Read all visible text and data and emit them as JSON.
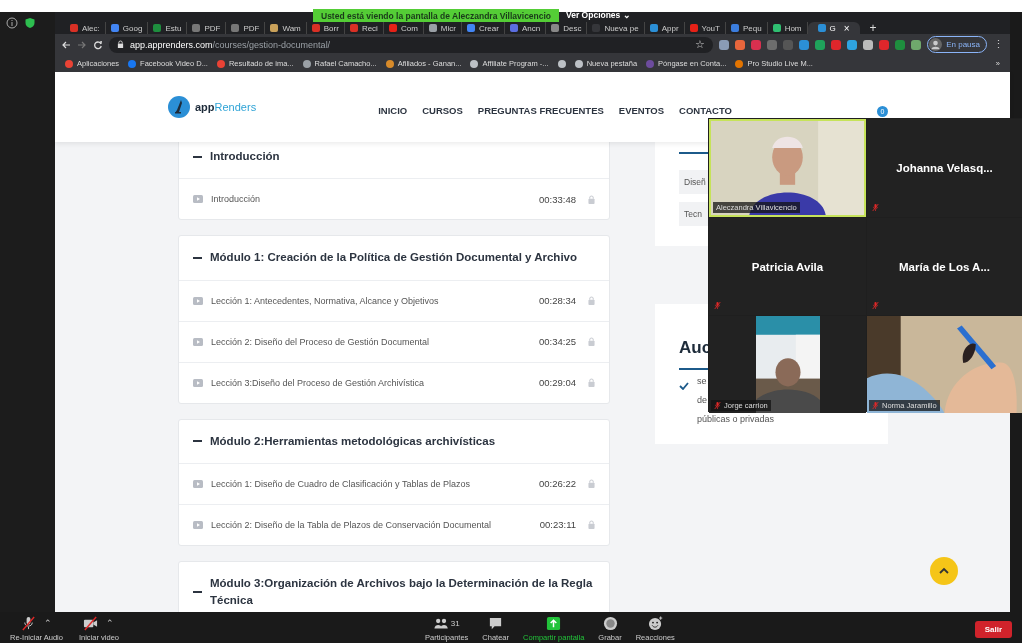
{
  "share_banner": {
    "text": "Usted está viendo la pantalla de Aleczandra Villavicencio",
    "options": "Ver Opciones ⌄"
  },
  "browser": {
    "tabs": [
      {
        "label": "Alec:",
        "color": "#d93025",
        "selected": false
      },
      {
        "label": "Goog",
        "color": "#4285f4",
        "selected": false
      },
      {
        "label": "Estu",
        "color": "#1e8e3e",
        "selected": false
      },
      {
        "label": "PDF",
        "color": "#777777",
        "selected": false
      },
      {
        "label": "PDF",
        "color": "#777777",
        "selected": false
      },
      {
        "label": "Wam",
        "color": "#c9a15a",
        "selected": false
      },
      {
        "label": "Borr",
        "color": "#d93025",
        "selected": false
      },
      {
        "label": "Reci",
        "color": "#d93025",
        "selected": false
      },
      {
        "label": "Com",
        "color": "#e62117",
        "selected": false
      },
      {
        "label": "Micr",
        "color": "#9aa0a6",
        "selected": false
      },
      {
        "label": "Crear",
        "color": "#4285f4",
        "selected": false
      },
      {
        "label": "Ancn",
        "color": "#5b6ee1",
        "selected": false
      },
      {
        "label": "Desc",
        "color": "#888888",
        "selected": false
      },
      {
        "label": "Nueva pe",
        "color": "#35363a",
        "selected": false
      },
      {
        "label": "Appr",
        "color": "#2b8fd6",
        "selected": false
      },
      {
        "label": "YouT",
        "color": "#e62117",
        "selected": false
      },
      {
        "label": "Pequ",
        "color": "#3b7ddd",
        "selected": false
      },
      {
        "label": "Hom",
        "color": "#2fbf71",
        "selected": false
      },
      {
        "label": "G",
        "color": "#2b8fd6",
        "selected": true
      }
    ],
    "new_tab": "+",
    "close_tab": "×",
    "star": "☆",
    "menu": "⋮",
    "address": "**app.apprenders.com**/courses/gestion-documental/",
    "extensions": [
      {
        "color": "#8a9bb5"
      },
      {
        "color": "#e8663c"
      },
      {
        "color": "#d9304f"
      },
      {
        "color": "#6d6d6d"
      },
      {
        "color": "#555555"
      },
      {
        "color": "#2b8fd6"
      },
      {
        "color": "#1fa35b"
      },
      {
        "color": "#e0262b"
      },
      {
        "color": "#2ea3e0"
      },
      {
        "color": "#bbbbbb"
      },
      {
        "color": "#e0262b"
      },
      {
        "color": "#1e8e3e"
      },
      {
        "color": "#6fa86c"
      }
    ],
    "profile": "En pausa",
    "bookmarks": [
      {
        "label": "Aplicaciones",
        "color": "#ea4335"
      },
      {
        "label": "Facebook Video D...",
        "color": "#1877f2"
      },
      {
        "label": "Resultado de ima...",
        "color": "#e94235"
      },
      {
        "label": "Rafael Camacho...",
        "color": "#9aa0a6"
      },
      {
        "label": "Afiliados - Ganan...",
        "color": "#d88b2a"
      },
      {
        "label": "Affiliate Program -...",
        "color": "#bdc1c6"
      },
      {
        "color": "#bdc1c6"
      },
      {
        "label": "Nueva pestaña",
        "color": "#bdc1c6"
      },
      {
        "label": "Póngase en Conta...",
        "color": "#6d4c9e"
      },
      {
        "label": "Pro Studio Live M...",
        "color": "#e37400"
      }
    ],
    "more": "»"
  },
  "site": {
    "brand_plain": "app",
    "brand_accent": "Renders",
    "nav": [
      "INICIO",
      "CURSOS",
      "PREGUNTAS FRECUENTES",
      "EVENTOS",
      "CONTACTO"
    ],
    "cart_count": "0"
  },
  "modules": [
    {
      "title": "Introducción",
      "lessons": [
        {
          "title": "Introducción",
          "duration": "00:33:48"
        }
      ]
    },
    {
      "title": "Módulo 1: Creación de la Política de Gestión Documental y Archivo",
      "lessons": [
        {
          "title": "Lección 1: Antecedentes, Normativa, Alcance y Objetivos",
          "duration": "00:28:34"
        },
        {
          "title": "Lección 2: Diseño del Proceso de Gestión Documental",
          "duration": "00:34:25"
        },
        {
          "title": "Lección 3:Diseño del Proceso de Gestión Archivística",
          "duration": "00:29:04"
        }
      ]
    },
    {
      "title": "Módulo 2:Herramientas metodológicas archivísticas",
      "lessons": [
        {
          "title": "Lección 1: Diseño de Cuadro de Clasificación y Tablas de Plazos",
          "duration": "00:26:22"
        },
        {
          "title": "Lección 2: Diseño de la Tabla de Plazos de Conservación Documental",
          "duration": "00:23:11"
        }
      ]
    },
    {
      "title": "Módulo 3:Organización de Archivos bajo la Determinación de la Regla Técnica"
    }
  ],
  "sidebar": {
    "tags": [
      "Diseñ",
      "Tecn"
    ],
    "audience_heading": "Auc",
    "audience_lines": [
      "se",
      "de",
      "públicas o privadas"
    ]
  },
  "meeting": {
    "participants": [
      {
        "name": "Aleczandra Villavicencio",
        "kind": "video",
        "muted": false,
        "speaking": true
      },
      {
        "name": "Johanna  Velasq...",
        "kind": "name",
        "muted": true,
        "speaking": false
      },
      {
        "name": "Patricia Avila",
        "kind": "name",
        "muted": true,
        "speaking": false
      },
      {
        "name": "María  de Los A...",
        "kind": "name",
        "muted": true,
        "speaking": false
      },
      {
        "name": "Jorge carrion",
        "kind": "video-narrow",
        "muted": true,
        "speaking": false
      },
      {
        "name": "Norma Jaramillo",
        "kind": "video",
        "muted": true,
        "speaking": false
      }
    ],
    "toolbar": [
      {
        "kind": "mic",
        "label": "Re-Iniciar Audio",
        "muted": true,
        "caret": "⌃"
      },
      {
        "kind": "camera",
        "label": "Iniciar video",
        "muted": true,
        "caret": "⌃"
      },
      {
        "kind": "participants",
        "label": "Participantes",
        "count": "31"
      },
      {
        "kind": "chat",
        "label": "Chatear"
      },
      {
        "kind": "share",
        "label": "Compartir pantalla"
      },
      {
        "kind": "record",
        "label": "Grabar"
      },
      {
        "kind": "reactions",
        "label": "Reacciones"
      }
    ],
    "leave": "Salir"
  }
}
